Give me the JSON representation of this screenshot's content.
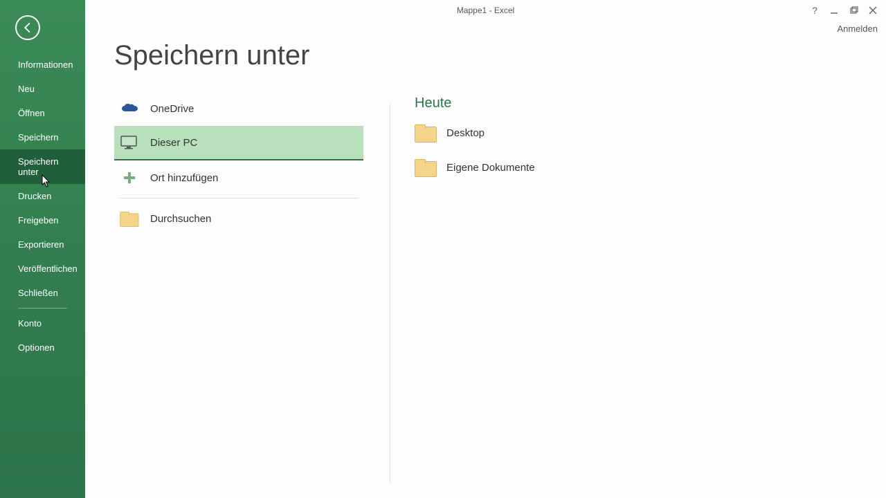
{
  "title": "Mappe1 - Excel",
  "signin": "Anmelden",
  "sidebar": {
    "items": [
      {
        "label": "Informationen"
      },
      {
        "label": "Neu"
      },
      {
        "label": "Öffnen"
      },
      {
        "label": "Speichern"
      },
      {
        "label": "Speichern unter",
        "selected": true
      },
      {
        "label": "Drucken"
      },
      {
        "label": "Freigeben"
      },
      {
        "label": "Exportieren"
      },
      {
        "label": "Veröffentlichen"
      },
      {
        "label": "Schließen"
      }
    ],
    "bottom": [
      {
        "label": "Konto"
      },
      {
        "label": "Optionen"
      }
    ]
  },
  "page": {
    "heading": "Speichern unter"
  },
  "locations": [
    {
      "label": "OneDrive"
    },
    {
      "label": "Dieser PC",
      "selected": true
    },
    {
      "label": "Ort hinzufügen"
    },
    {
      "label": "Durchsuchen"
    }
  ],
  "recent": {
    "section": "Heute",
    "folders": [
      {
        "label": "Desktop"
      },
      {
        "label": "Eigene Dokumente"
      }
    ]
  }
}
